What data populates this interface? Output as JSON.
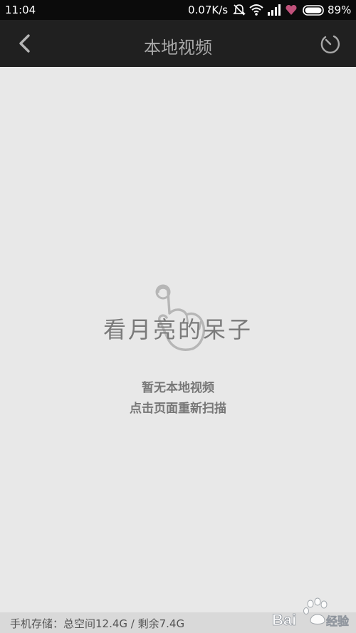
{
  "status_bar": {
    "time": "11:04",
    "net_speed": "0.07K/s",
    "battery_percent": "89%",
    "icons": [
      "bell-muted-icon",
      "wifi-icon",
      "signal-icon",
      "heart-icon",
      "battery-icon"
    ]
  },
  "app_bar": {
    "title": "本地视频",
    "back_icon": "chevron-left-icon",
    "action_icon": "scan-refresh-icon"
  },
  "empty_state": {
    "watermark_text": "看月亮的呆子",
    "line1": "暂无本地视频",
    "line2": "点击页面重新扫描"
  },
  "storage": {
    "text": "手机存储：总空间12.4G / 剩余7.4G"
  },
  "watermark": {
    "baidu_logo": "Bai",
    "baidu_suffix": "经验"
  },
  "colors": {
    "status_bg": "#0b0b0b",
    "app_bar_bg": "#202020",
    "page_bg": "#e8e8e8",
    "accent_heart": "#c0517a"
  }
}
